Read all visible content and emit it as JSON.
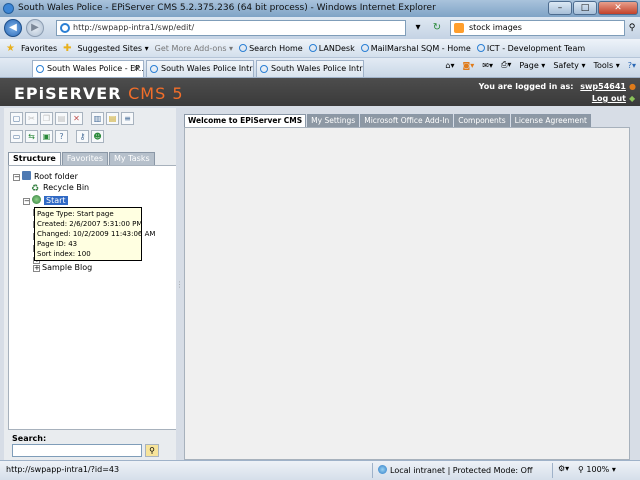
{
  "window": {
    "title": "South Wales Police - EPiServer CMS 5.2.375.236 (64 bit process) - Windows Internet Explorer",
    "min_label": "–",
    "max_label": "□",
    "close_label": "✕"
  },
  "address_bar": {
    "url": "http://swpapp-intra1/swp/edit/",
    "search_text": "stock images"
  },
  "favorites_bar": {
    "favorites_label": "Favorites",
    "items": [
      "Suggested Sites ▾",
      "Get More Add-ons ▾",
      "Search Home",
      "LANDesk",
      "MailMarshal SQM - Home",
      "ICT - Development Team"
    ]
  },
  "tabs": {
    "items": [
      {
        "label": "South Wales Police - EP..."
      },
      {
        "label": "South Wales Police Intranet"
      },
      {
        "label": "South Wales Police Intranet"
      }
    ],
    "tools": [
      "Page ▾",
      "Safety ▾",
      "Tools ▾"
    ]
  },
  "header": {
    "logo_main": "EPiSERVER",
    "logo_cms": "CMS 5",
    "logged_in_label": "You are logged in as:",
    "username": "swp54641",
    "logout_label": "Log out"
  },
  "left_panel": {
    "tabs": [
      "Structure",
      "Favorites",
      "My Tasks"
    ],
    "tree": {
      "root": "Root folder",
      "recycle": "Recycle Bin",
      "start": "Start",
      "sample_blog": "Sample Blog"
    },
    "tooltip": {
      "page_type": "Page Type: Start page",
      "created": "Created: 2/6/2007 5:31:00 PM",
      "changed": "Changed: 10/2/2009 11:43:06 AM",
      "page_id": "Page ID: 43",
      "sort_index": "Sort index: 100"
    },
    "search_label": "Search:"
  },
  "right_panel": {
    "tabs": [
      "Welcome to EPiServer CMS",
      "My Settings",
      "Microsoft Office Add-In",
      "Components",
      "License Agreement"
    ]
  },
  "status_bar": {
    "url": "http://swpapp-intra1/?id=43",
    "zone": "Local intranet | Protected Mode: Off",
    "zoom": "100%"
  }
}
